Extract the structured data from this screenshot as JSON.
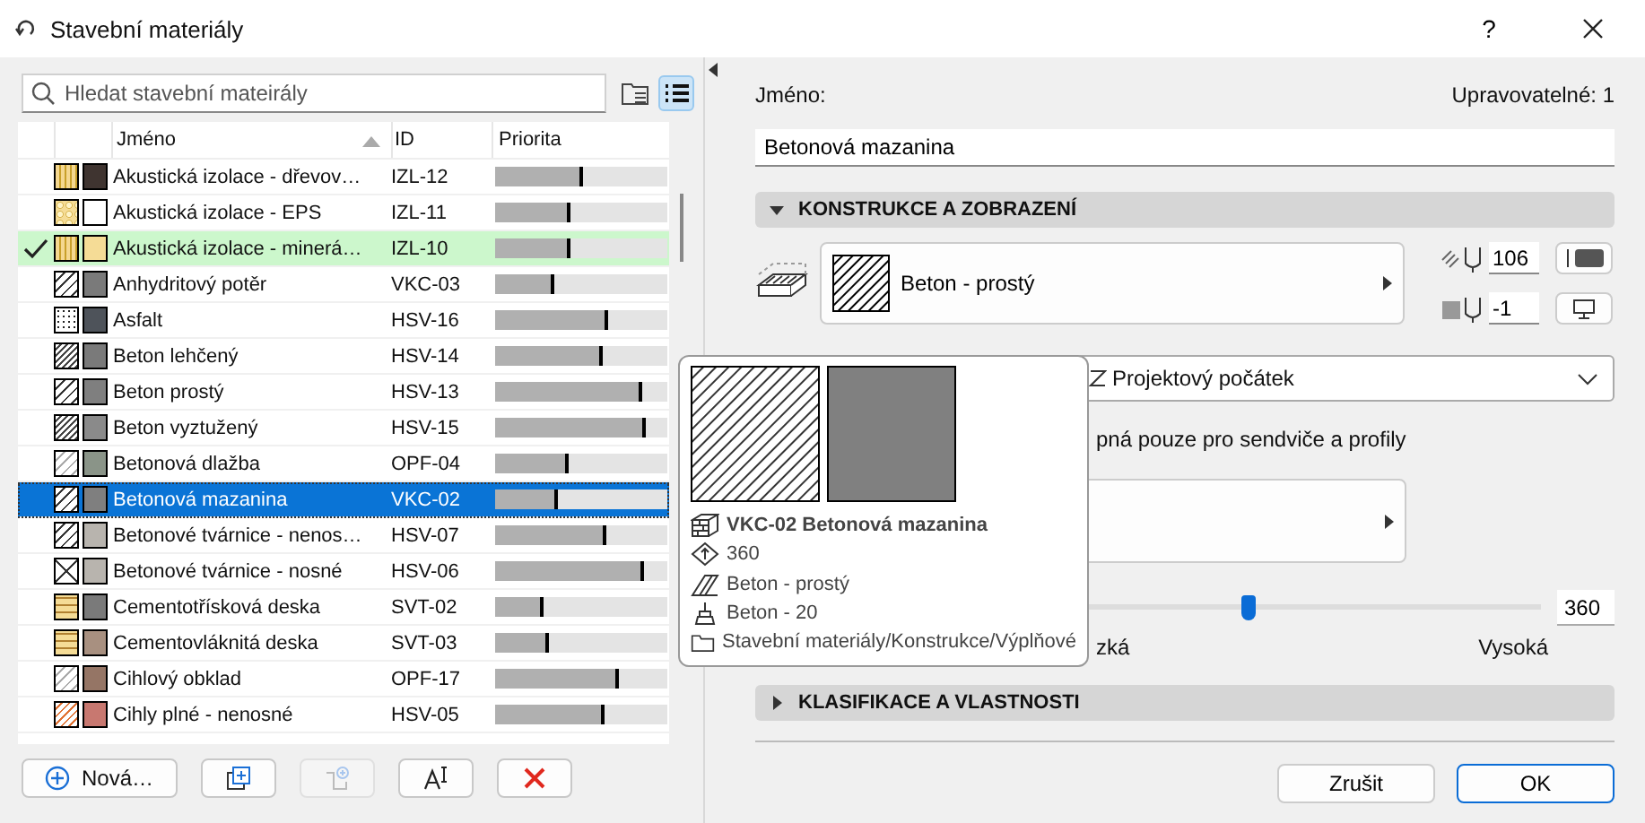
{
  "window": {
    "title": "Stavební materiály",
    "help": "?"
  },
  "search": {
    "placeholder": "Hledat stavební mateirály"
  },
  "view_buttons": [
    {
      "kind": "tree",
      "selected": false
    },
    {
      "kind": "list",
      "selected": true
    }
  ],
  "table": {
    "columns": [
      {
        "label": "Jméno",
        "sorted": true
      },
      {
        "label": "ID",
        "sorted": false
      },
      {
        "label": "Priorita",
        "sorted": false
      }
    ],
    "rows": [
      {
        "name": "Akustická izolace - dřevov…",
        "id": "IZL-12",
        "level": 0.51,
        "kind": "wave",
        "color": "#3f3430",
        "checked": false,
        "selected": false
      },
      {
        "name": "Akustická izolace - EPS",
        "id": "IZL-11",
        "level": 0.44,
        "kind": "eps",
        "color": "#ffffff",
        "checked": false,
        "selected": false
      },
      {
        "name": "Akustická izolace - minerá…",
        "id": "IZL-10",
        "level": 0.44,
        "kind": "wave",
        "color": "#f5dc96",
        "checked": true,
        "selected": false
      },
      {
        "name": "Anhydritový potěr",
        "id": "VKC-03",
        "level": 0.34,
        "kind": "hatch",
        "color": "#7a7a7a",
        "checked": false,
        "selected": false
      },
      {
        "name": "Asfalt",
        "id": "HSV-16",
        "level": 0.66,
        "kind": "dots",
        "color": "#4e535a",
        "checked": false,
        "selected": false
      },
      {
        "name": "Beton lehčený",
        "id": "HSV-14",
        "level": 0.62,
        "kind": "hatch-dense",
        "color": "#7a7a7a",
        "checked": false,
        "selected": false
      },
      {
        "name": "Beton prostý",
        "id": "HSV-13",
        "level": 0.85,
        "kind": "hatch",
        "color": "#7f7f7f",
        "checked": false,
        "selected": false
      },
      {
        "name": "Beton vyztužený",
        "id": "HSV-15",
        "level": 0.87,
        "kind": "hatch-dense",
        "color": "#8a8a8a",
        "checked": false,
        "selected": false
      },
      {
        "name": "Betonová dlažba",
        "id": "OPF-04",
        "level": 0.43,
        "kind": "hatch-light",
        "color": "#8a9488",
        "checked": false,
        "selected": false
      },
      {
        "name": "Betonová mazanina",
        "id": "VKC-02",
        "level": 0.36,
        "kind": "hatch",
        "color": "#7f7f7f",
        "checked": false,
        "selected": true
      },
      {
        "name": "Betonové tvárnice - nenos…",
        "id": "HSV-07",
        "level": 0.65,
        "kind": "hatch",
        "color": "#b8b4ae",
        "checked": false,
        "selected": false
      },
      {
        "name": "Betonové tvárnice - nosné",
        "id": "HSV-06",
        "level": 0.86,
        "kind": "cross",
        "color": "#b8b4ae",
        "checked": false,
        "selected": false
      },
      {
        "name": "Cementotřísková deska",
        "id": "SVT-02",
        "level": 0.28,
        "kind": "brick",
        "color": "#7a7a7a",
        "checked": false,
        "selected": false
      },
      {
        "name": "Cementovláknitá deska",
        "id": "SVT-03",
        "level": 0.31,
        "kind": "brick",
        "color": "#a89080",
        "checked": false,
        "selected": false
      },
      {
        "name": "Cihlový obklad",
        "id": "OPF-17",
        "level": 0.72,
        "kind": "hatch-light",
        "color": "#957565",
        "checked": false,
        "selected": false
      },
      {
        "name": "Cihly plné - nenosné",
        "id": "HSV-05",
        "level": 0.64,
        "kind": "brick-orange",
        "color": "#c87870",
        "checked": false,
        "selected": false
      }
    ]
  },
  "list_buttons": [
    {
      "kind": "new",
      "label": "Nová…",
      "disabled": false
    },
    {
      "kind": "duplicate",
      "disabled": false
    },
    {
      "kind": "import",
      "disabled": true
    },
    {
      "kind": "rename",
      "disabled": false
    },
    {
      "kind": "delete",
      "disabled": false
    }
  ],
  "details": {
    "name_label": "Jméno:",
    "editable": "Upravovatelné: 1",
    "name_value": "Betonová mazanina"
  },
  "construction": {
    "title": "KONSTRUKCE A ZOBRAZENÍ",
    "expanded": true,
    "fill": "Beton - prostý",
    "fill_pen": "106",
    "background_pen": "-1",
    "origin": "Projektový počátek",
    "note": "pná pouze pro sendviče a profily",
    "slider": {
      "level": 0.61,
      "value": "360",
      "low_label": "zká",
      "high_label": "Vysoká"
    }
  },
  "classification": {
    "title": "KLASIFIKACE A VLASTNOSTI",
    "expanded": false
  },
  "dialog_buttons": [
    {
      "label": "Zrušit",
      "default": false
    },
    {
      "label": "OK",
      "default": true
    }
  ],
  "tooltip": {
    "title": "VKC-02 Betonová mazanina",
    "lines": [
      {
        "kind": "priority",
        "text": "360"
      },
      {
        "kind": "fill",
        "text": "Beton - prostý"
      },
      {
        "kind": "surface",
        "text": "Beton - 20"
      },
      {
        "kind": "folder",
        "text": "Stavební materiály/Konstrukce/Výplňové"
      }
    ]
  }
}
